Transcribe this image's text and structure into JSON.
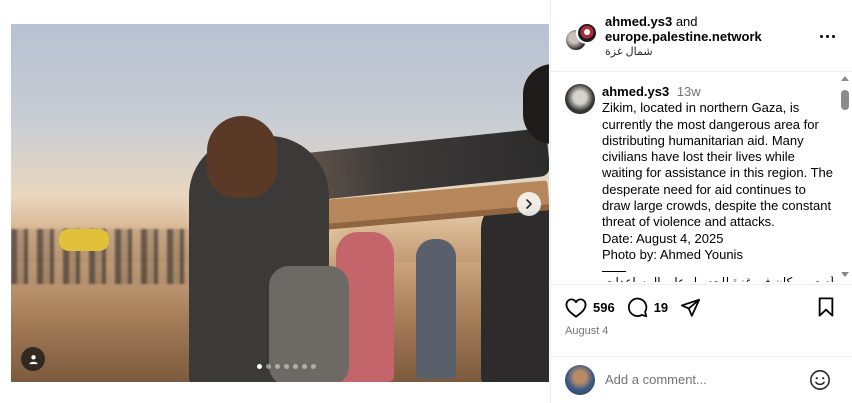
{
  "post": {
    "header": {
      "author_primary": "ahmed.ys3",
      "joiner": "and",
      "author_secondary": "europe.palestine.network",
      "location": "شمال غزة"
    },
    "caption": {
      "username": "ahmed.ys3",
      "time_ago": "13w",
      "lines": [
        "Zikim, located in northern Gaza, is",
        "currently the most dangerous area for",
        "distributing humanitarian aid. Many",
        "civilians have lost their lives while",
        "waiting for assistance in this region. The",
        "desperate need for aid continues to",
        "draw large crowds, despite the constant",
        "threat of violence and attacks.",
        "Date: August 4, 2025",
        "Photo by: Ahmed Younis"
      ],
      "cut_line": "أصعب مكان في غزة للحصول على المساعدات"
    },
    "actions": {
      "like_count": "596",
      "comment_count": "19"
    },
    "date": "August 4",
    "comment_box": {
      "placeholder": "Add a comment..."
    },
    "carousel": {
      "slides": 7,
      "active_index": 0
    }
  },
  "icons": {
    "like": "heart-icon",
    "comment": "comment-bubble-icon",
    "share": "paper-plane-icon",
    "save": "bookmark-icon",
    "emoji": "smiley-icon",
    "more": "ellipsis-icon",
    "next": "chevron-right-icon",
    "tags": "user-tag-icon"
  }
}
